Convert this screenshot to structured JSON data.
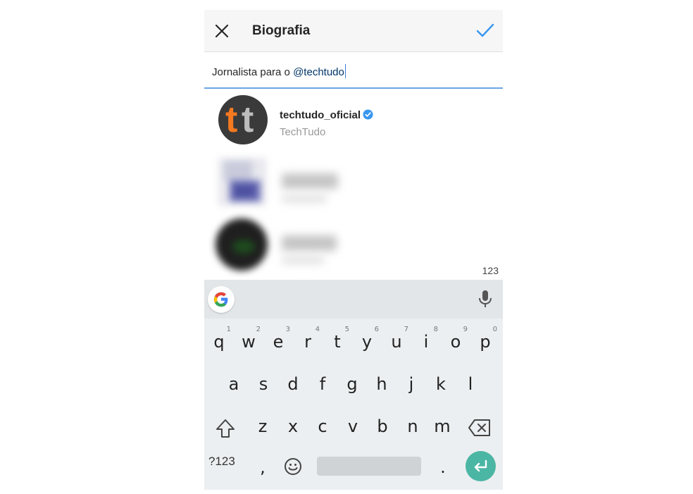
{
  "header": {
    "title": "Biografia",
    "close_icon": "close-icon",
    "confirm_icon": "checkmark-icon",
    "accent_color": "#3897f0"
  },
  "bio": {
    "text_prefix": "Jornalista para o ",
    "mention": "@techtudo"
  },
  "suggestions": [
    {
      "username": "techtudo_oficial",
      "full_name": "TechTudo",
      "verified": true,
      "avatar_letters": [
        "t",
        "t"
      ]
    },
    {
      "username": "",
      "full_name": "",
      "blurred": true
    },
    {
      "username": "",
      "full_name": "",
      "blurred": true
    }
  ],
  "char_counter": "123",
  "keyboard": {
    "row1": [
      "q",
      "w",
      "e",
      "r",
      "t",
      "y",
      "u",
      "i",
      "o",
      "p"
    ],
    "row1_hints": [
      "1",
      "2",
      "3",
      "4",
      "5",
      "6",
      "7",
      "8",
      "9",
      "0"
    ],
    "row2": [
      "a",
      "s",
      "d",
      "f",
      "g",
      "h",
      "j",
      "k",
      "l"
    ],
    "row3": [
      "z",
      "x",
      "c",
      "v",
      "b",
      "n",
      "m"
    ],
    "symbols_label": "?123",
    "comma": ",",
    "period": ".",
    "google_icon": "google-icon",
    "mic_icon": "mic-icon",
    "shift_icon": "shift-icon",
    "backspace_icon": "backspace-icon",
    "emoji_icon": "emoji-icon",
    "enter_icon": "enter-icon",
    "enter_color": "#4cb6a4"
  }
}
